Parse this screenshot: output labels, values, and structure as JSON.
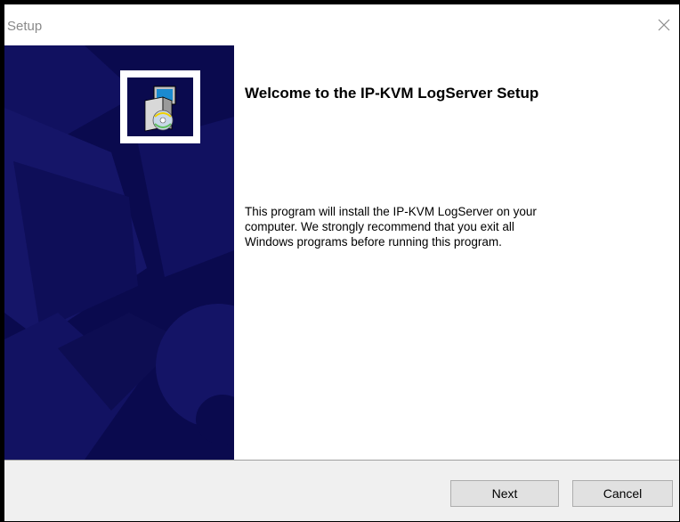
{
  "window": {
    "title": "Setup",
    "close_icon": "close-icon"
  },
  "banner": {
    "logo_icon": "setup-installer-icon"
  },
  "content": {
    "heading": "Welcome to the IP-KVM LogServer Setup",
    "body_lines": [
      "This program will install the IP-KVM LogServer on your",
      "computer. We strongly recommend that you exit all",
      "Windows programs before running this program."
    ]
  },
  "buttons": {
    "next_label": "Next",
    "cancel_label": "Cancel"
  },
  "colors": {
    "banner_bg": "#0a0a4e",
    "banner_shape": "#16166e",
    "footer_bg": "#f0f0f0",
    "button_bg": "#e1e1e1"
  }
}
